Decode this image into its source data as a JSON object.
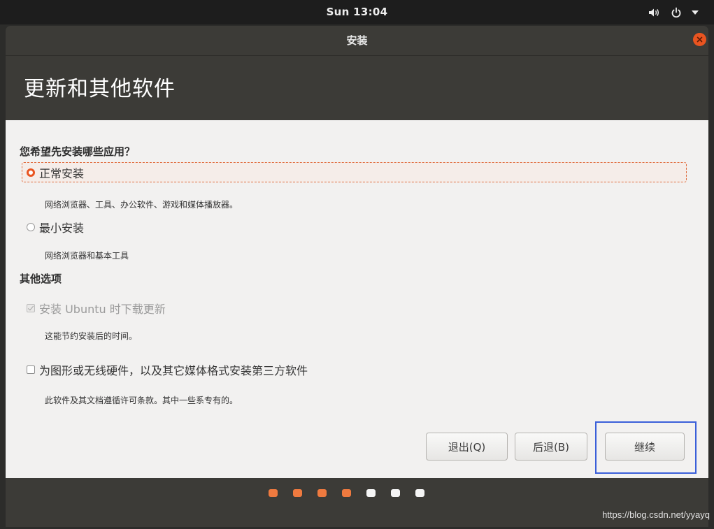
{
  "topbar": {
    "clock": "Sun 13:04",
    "icons": [
      "volume-icon",
      "power-icon",
      "chevron-down-icon"
    ]
  },
  "window": {
    "title": "安装",
    "close_icon": "close-icon"
  },
  "page": {
    "title": "更新和其他软件"
  },
  "content": {
    "question": "您希望先安装哪些应用？",
    "normal_install": {
      "label": "正常安装",
      "desc": "网络浏览器、工具、办公软件、游戏和媒体播放器。",
      "checked": true
    },
    "minimal_install": {
      "label": "最小安装",
      "desc": "网络浏览器和基本工具",
      "checked": false
    },
    "other_options": "其他选项",
    "download_updates": {
      "label": "安装 Ubuntu 时下载更新",
      "desc": "这能节约安装后的时间。",
      "checked": true,
      "disabled": true
    },
    "third_party": {
      "label": "为图形或无线硬件，以及其它媒体格式安装第三方软件",
      "desc": "此软件及其文档遵循许可条款。其中一些系专有的。",
      "checked": false
    }
  },
  "buttons": {
    "quit": "退出(Q)",
    "back": "后退(B)",
    "continue": "继续"
  },
  "progress": {
    "total_steps": 7,
    "completed_steps": 4
  },
  "watermark": "https://blog.csdn.net/yyayq",
  "colors": {
    "accent": "#e95420",
    "highlight": "#3a5fd9"
  }
}
